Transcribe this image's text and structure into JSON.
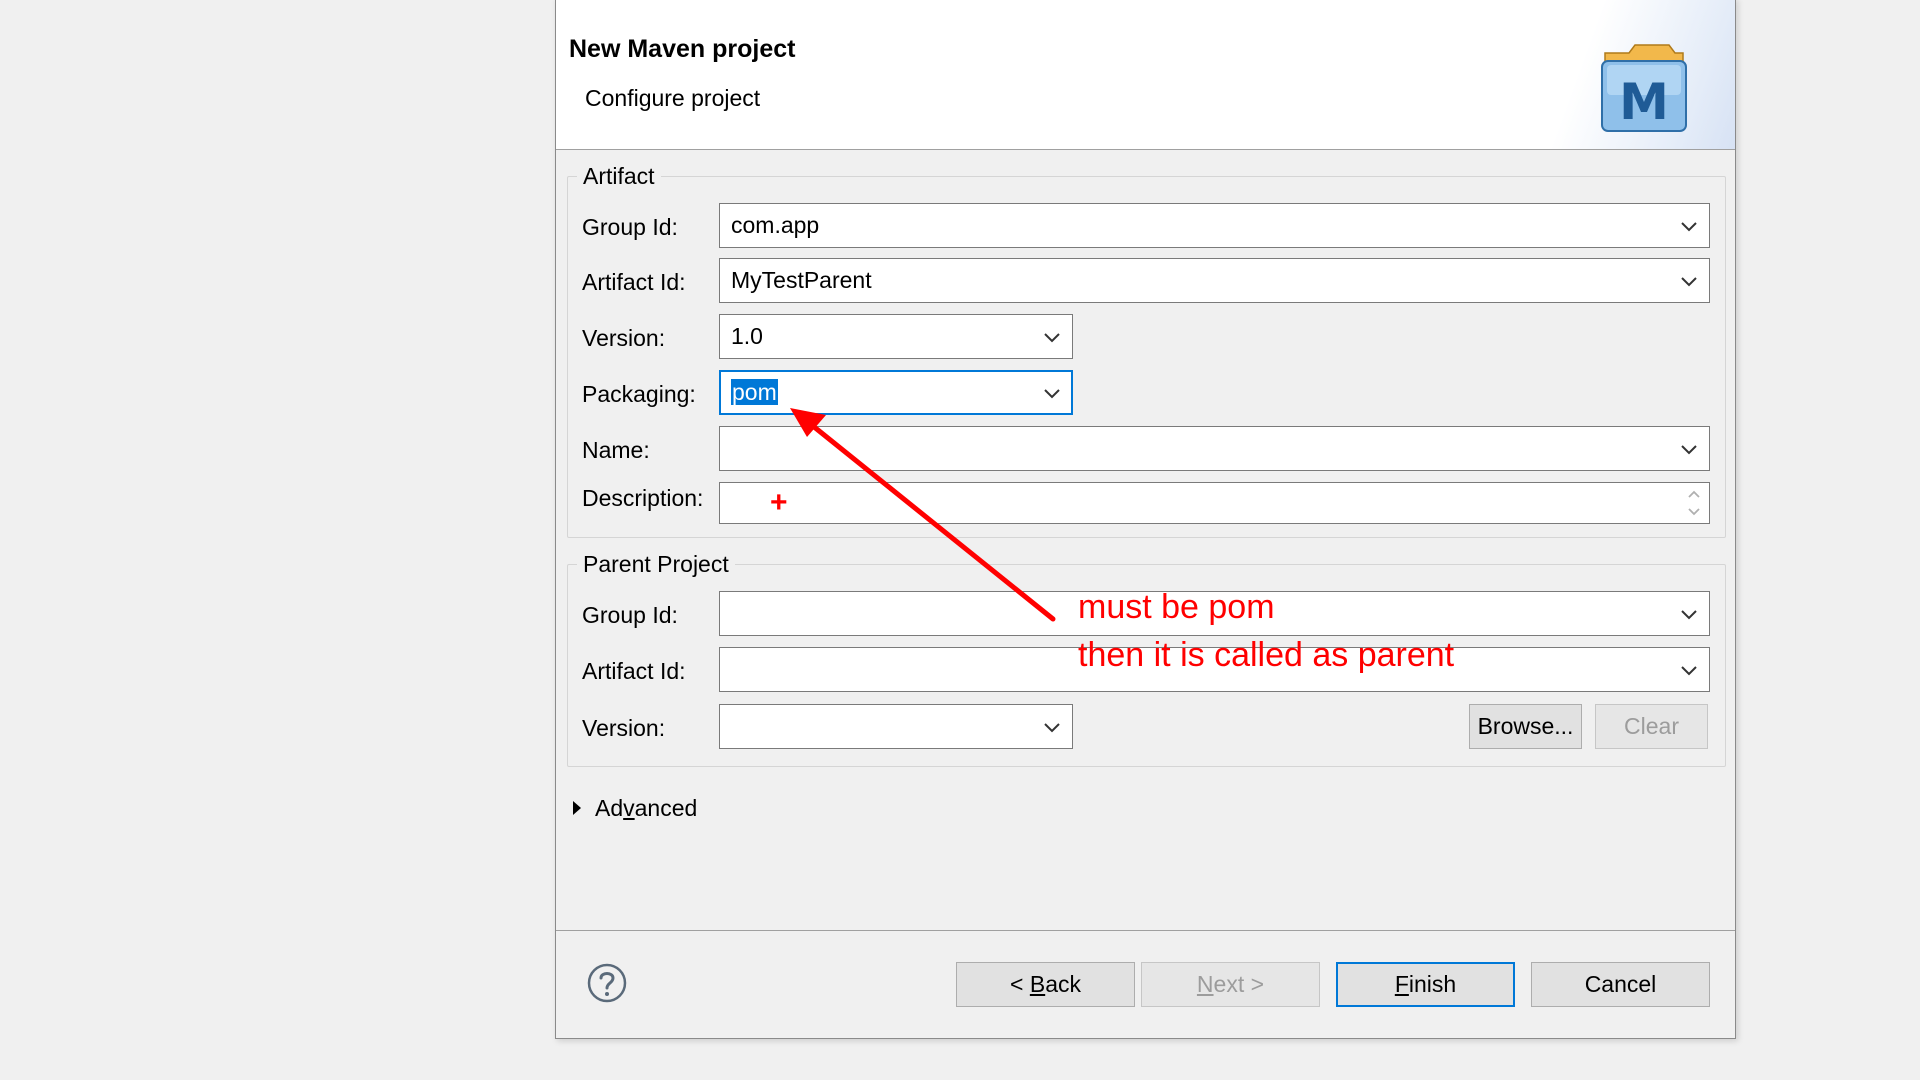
{
  "dialog": {
    "title": "New Maven project",
    "subtitle": "Configure project",
    "logo_letter": "M"
  },
  "artifact": {
    "legend": "Artifact",
    "group_id_label": "Group Id:",
    "group_id_value": "com.app",
    "artifact_id_label": "Artifact Id:",
    "artifact_id_value": "MyTestParent",
    "version_label": "Version:",
    "version_value": "1.0",
    "packaging_label": "Packaging:",
    "packaging_value": "pom",
    "name_label": "Name:",
    "name_value": "",
    "description_label": "Description:",
    "description_value": ""
  },
  "parent": {
    "legend": "Parent Project",
    "group_id_label": "Group Id:",
    "group_id_value": "",
    "artifact_id_label": "Artifact Id:",
    "artifact_id_value": "",
    "version_label": "Version:",
    "version_value": "",
    "browse_label": "Browse...",
    "clear_label": "Clear"
  },
  "advanced": {
    "label_pre": "Ad",
    "label_mnemonic": "v",
    "label_post": "anced"
  },
  "footer": {
    "back": {
      "pre": "< ",
      "mn": "B",
      "post": "ack"
    },
    "next": {
      "pre": "",
      "mn": "N",
      "post": "ext >"
    },
    "finish": {
      "pre": "",
      "mn": "F",
      "post": "inish"
    },
    "cancel": "Cancel"
  },
  "annotation": {
    "line1": "must be pom",
    "line2": "then it is called as parent",
    "plus": "+"
  },
  "colors": {
    "accent": "#0078d7",
    "annotation": "#ff0000",
    "dialog_bg": "#f0f0f0"
  },
  "icons": {
    "logo": "maven-logo-icon",
    "help": "help-icon",
    "dropdown": "chevron-down-icon",
    "expand": "triangle-right-icon"
  }
}
